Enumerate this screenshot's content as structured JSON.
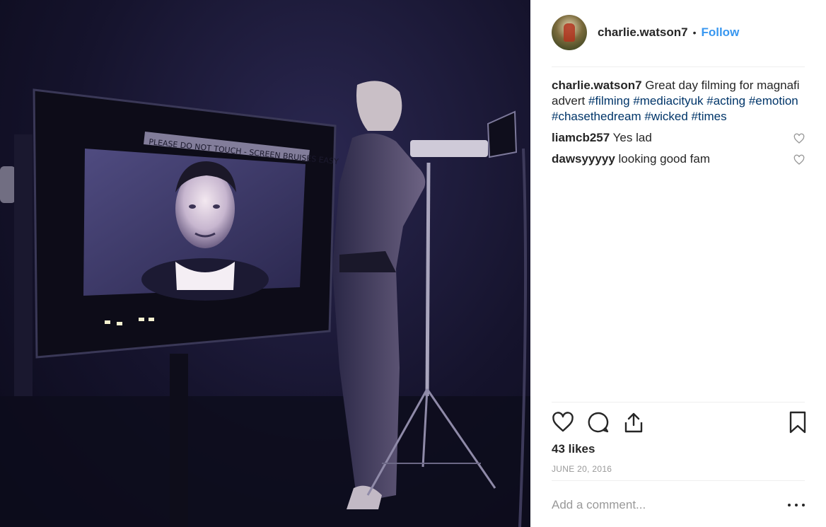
{
  "post": {
    "username": "charlie.watson7",
    "separator": "•",
    "follow_label": "Follow"
  },
  "caption": {
    "username": "charlie.watson7",
    "text": "Great day filming for magnafi advert",
    "hashtags": [
      "#filming",
      "#mediacityuk",
      "#acting",
      "#emotion",
      "#chasethedream",
      "#wicked",
      "#times"
    ]
  },
  "comments": [
    {
      "username": "liamcb257",
      "text": "Yes lad"
    },
    {
      "username": "dawsyyyyy",
      "text": "looking good fam"
    }
  ],
  "stats": {
    "likes": "43 likes",
    "date": "JUNE 20, 2016"
  },
  "comment_box": {
    "placeholder": "Add a comment..."
  },
  "icons": {
    "like": "heart-icon",
    "comment": "comment-bubble-icon",
    "share": "share-icon",
    "save": "bookmark-icon",
    "more": "more-options-icon"
  },
  "colors": {
    "accent": "#3897f0",
    "hashtag": "#003569",
    "muted": "#999999",
    "photo_tint": "#1a1836"
  },
  "photo": {
    "monitor_sign": "PLEASE DO NOT TOUCH - SCREEN BRUISES EASY"
  }
}
